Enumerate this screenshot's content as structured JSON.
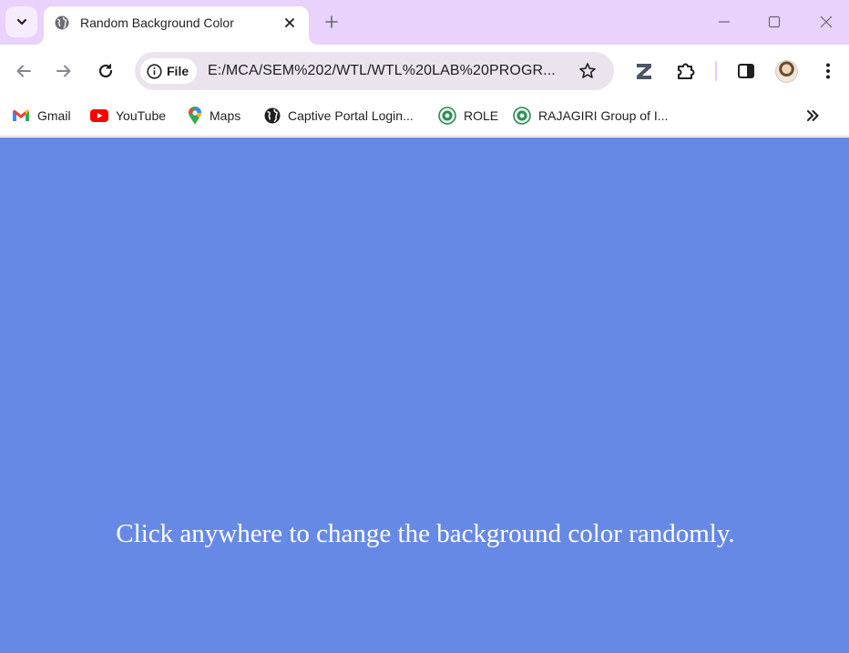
{
  "browser": {
    "tab": {
      "title": "Random Background Color",
      "favicon": "globe-icon"
    },
    "toolbar": {
      "url_chip_label": "File",
      "url": "E:/MCA/SEM%202/WTL/WTL%20LAB%20PROGR..."
    },
    "bookmarks": [
      {
        "label": "Gmail",
        "icon": "gmail-icon"
      },
      {
        "label": "YouTube",
        "icon": "youtube-icon"
      },
      {
        "label": "Maps",
        "icon": "maps-icon"
      },
      {
        "label": "Captive Portal Login...",
        "icon": "globe-icon"
      },
      {
        "label": "ROLE",
        "icon": "college-logo-icon"
      },
      {
        "label": "RAJAGIRI Group of I...",
        "icon": "college-logo-icon"
      }
    ]
  },
  "page": {
    "background_color": "#6789e6",
    "message": "Click anywhere to change the background color randomly."
  },
  "colors": {
    "tabstrip": "#e9d2fb",
    "omnibox": "#ebe4ef",
    "page_text": "#ffffff"
  }
}
